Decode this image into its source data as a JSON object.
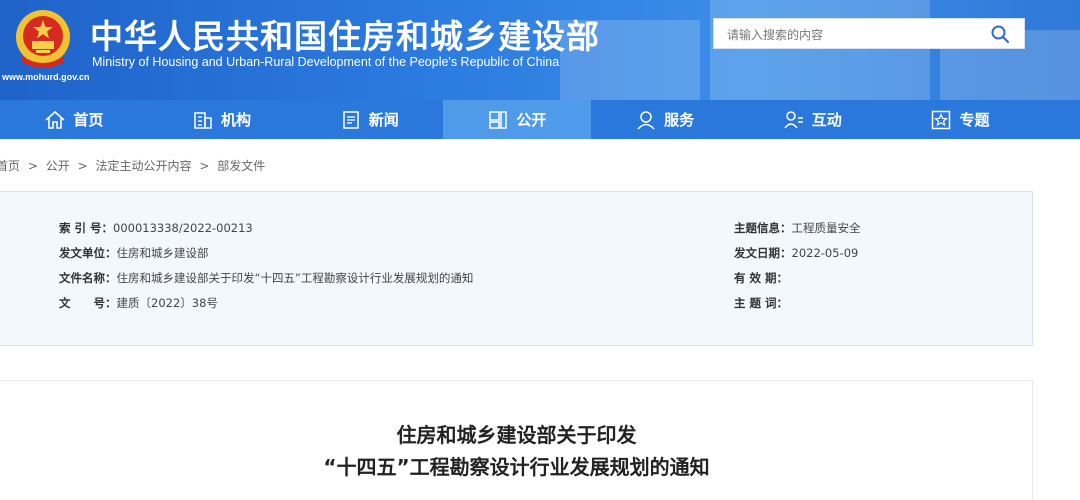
{
  "header": {
    "site_url": "www.mohurd.gov.cn",
    "title_cn": "中华人民共和国住房和城乡建设部",
    "title_en": "Ministry of Housing and Urban-Rural Development of the People's Republic of China",
    "search_placeholder": "请输入搜索的内容",
    "search_icon": "search-icon",
    "colors": {
      "header_bg": "#2c7be0",
      "nav_bg": "#2a78db",
      "nav_active": "#4f9bea"
    }
  },
  "nav": {
    "items": [
      {
        "label": "首页",
        "icon": "home-icon"
      },
      {
        "label": "机构",
        "icon": "building-icon"
      },
      {
        "label": "新闻",
        "icon": "document-icon"
      },
      {
        "label": "公开",
        "icon": "folder-icon",
        "active": true
      },
      {
        "label": "服务",
        "icon": "service-icon"
      },
      {
        "label": "互动",
        "icon": "people-icon"
      },
      {
        "label": "专题",
        "icon": "star-icon"
      }
    ]
  },
  "breadcrumb": {
    "items": [
      "首页",
      "公开",
      "法定主动公开内容",
      "部发文件"
    ],
    "separator": ">"
  },
  "info": {
    "index_label": "索 引 号：",
    "index_value": "000013338/2022-00213",
    "issuer_label": "发文单位：",
    "issuer_value": "住房和城乡建设部",
    "docname_label": "文件名称：",
    "docname_value": "住房和城乡建设部关于印发“十四五”工程勘察设计行业发展规划的通知",
    "docno_label": "文　　号：",
    "docno_value": "建质〔2022〕38号",
    "topic_label": "主题信息：",
    "topic_value": "工程质量安全",
    "date_label": "发文日期：",
    "date_value": "2022-05-09",
    "validity_label": "有 效 期：",
    "validity_value": "",
    "keywords_label": "主 题 词：",
    "keywords_value": ""
  },
  "article": {
    "title_line1": "住房和城乡建设部关于印发",
    "title_line2": "“十四五”工程勘察设计行业发展规划的通知"
  }
}
